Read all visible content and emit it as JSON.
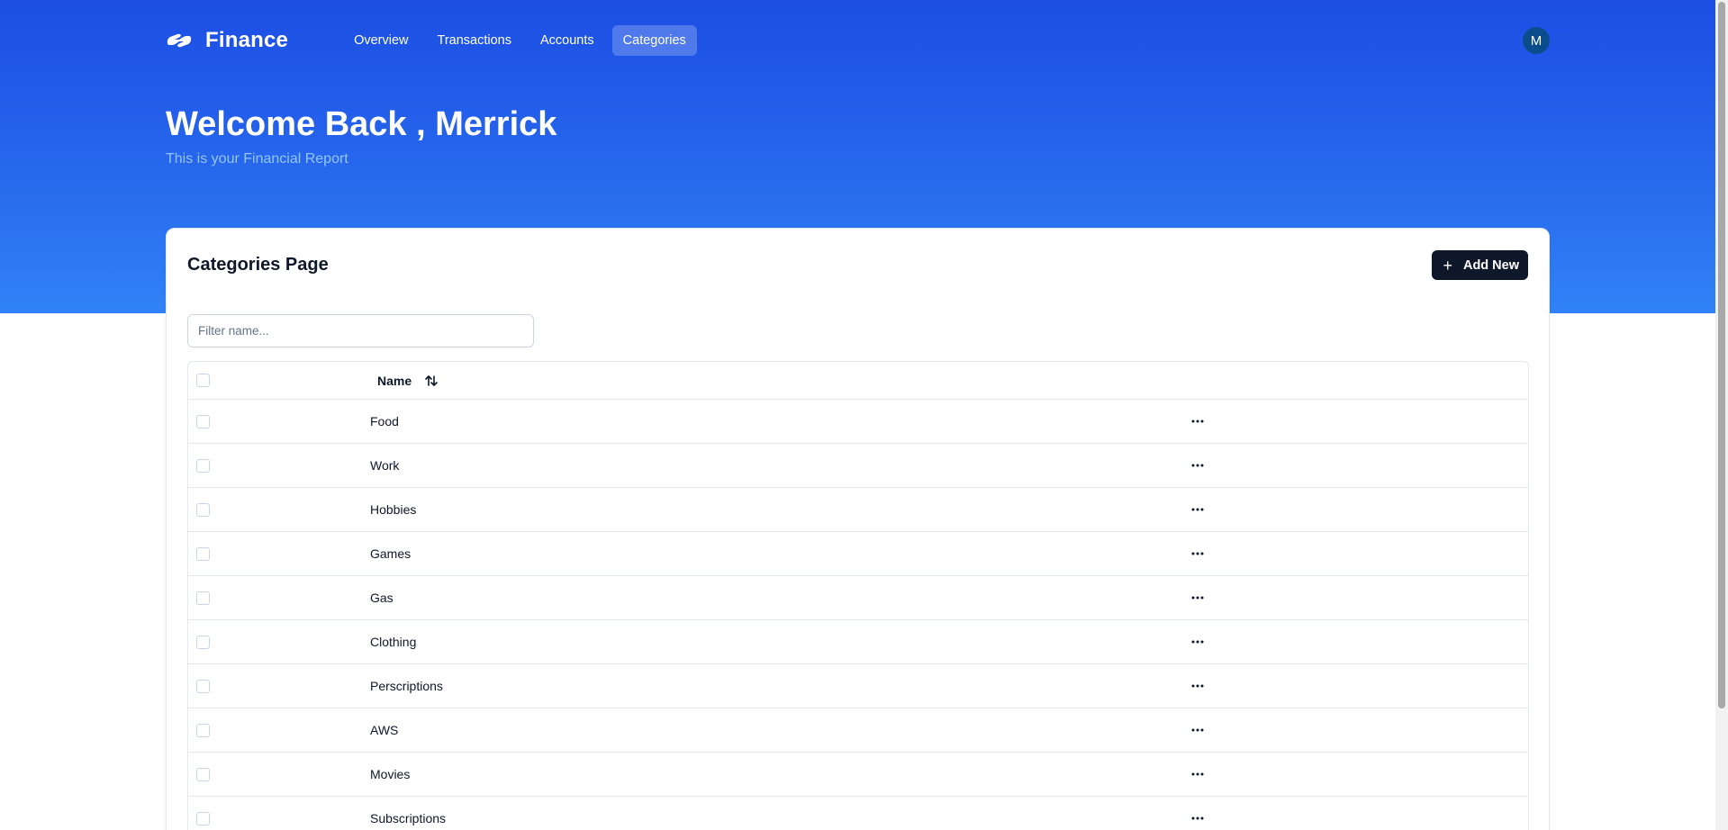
{
  "app": {
    "name": "Finance"
  },
  "nav": {
    "items": [
      {
        "label": "Overview",
        "active": false
      },
      {
        "label": "Transactions",
        "active": false
      },
      {
        "label": "Accounts",
        "active": false
      },
      {
        "label": "Categories",
        "active": true
      }
    ]
  },
  "user": {
    "initial": "M"
  },
  "hero": {
    "welcome": "Welcome Back , Merrick",
    "subtitle": "This is your Financial Report"
  },
  "page": {
    "title": "Categories Page",
    "add_label": "Add New",
    "filter_placeholder": "Filter name..."
  },
  "table": {
    "columns": [
      "Name"
    ],
    "rows": [
      {
        "name": "Food"
      },
      {
        "name": "Work"
      },
      {
        "name": "Hobbies"
      },
      {
        "name": "Games"
      },
      {
        "name": "Gas"
      },
      {
        "name": "Clothing"
      },
      {
        "name": "Perscriptions"
      },
      {
        "name": "AWS"
      },
      {
        "name": "Movies"
      },
      {
        "name": "Subscriptions"
      }
    ]
  },
  "icons": {
    "logo": "finance-logo-icon",
    "add": "plus-icon",
    "sort": "sort-arrows-icon",
    "row_menu": "more-horizontal-icon"
  },
  "colors": {
    "hero_top": "#1c4ee4",
    "hero_bottom": "#3182f6",
    "primary_button": "#0f172a",
    "avatar": "#0b4d8c",
    "subtitle": "#93c5fd"
  }
}
